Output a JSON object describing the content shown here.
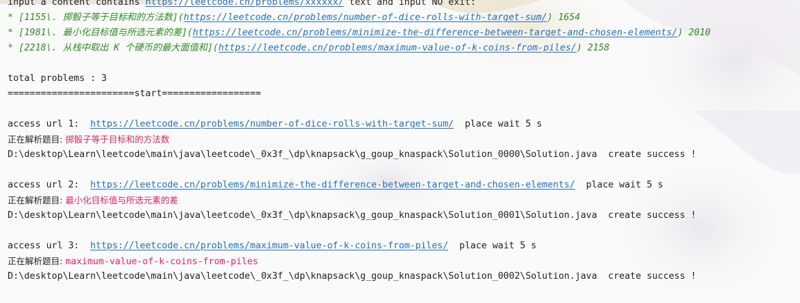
{
  "console": {
    "header": {
      "prefix": "input a content contains ",
      "link": "https://leetcode.cn/problems/xxxxxx/",
      "suffix": " text and input NO exit:"
    },
    "items": [
      {
        "prefix": "* [",
        "id": "1155\\.",
        "title_cn": " 掷骰子等于目标和的方法数",
        "mid": "](",
        "link": "https://leetcode.cn/problems/number-of-dice-rolls-with-target-sum/",
        "suffix": ") 1654"
      },
      {
        "prefix": "* [",
        "id": "1981\\.",
        "title_cn": " 最小化目标值与所选元素的差",
        "mid": "](",
        "link": "https://leetcode.cn/problems/minimize-the-difference-between-target-and-chosen-elements/",
        "suffix": ") 2010"
      },
      {
        "prefix": "* [",
        "id": "2218\\.",
        "title_cn": " 从栈中取出 K 个硬币的最大面值和",
        "mid": "](",
        "link": "https://leetcode.cn/problems/maximum-value-of-k-coins-from-piles/",
        "suffix": ") 2158"
      }
    ],
    "total": "total problems : 3",
    "start": "=======================start==================",
    "access": [
      {
        "prefix": "access url 1:  ",
        "link": "https://leetcode.cn/problems/number-of-dice-rolls-with-target-sum/",
        "wait": "  place wait 5 s",
        "parse_label": "正在解析题目: ",
        "parse_value": "掷骰子等于目标和的方法数",
        "path": "D:\\desktop\\Learn\\leetcode\\main\\java\\leetcode\\_0x3f_\\dp\\knapsack\\g_goup_knaspack\\Solution_0000\\Solution.java  create success !"
      },
      {
        "prefix": "access url 2:  ",
        "link": "https://leetcode.cn/problems/minimize-the-difference-between-target-and-chosen-elements/",
        "wait": "  place wait 5 s",
        "parse_label": "正在解析题目: ",
        "parse_value": "最小化目标值与所选元素的差",
        "path": "D:\\desktop\\Learn\\leetcode\\main\\java\\leetcode\\_0x3f_\\dp\\knapsack\\g_goup_knaspack\\Solution_0001\\Solution.java  create success !"
      },
      {
        "prefix": "access url 3:  ",
        "link": "https://leetcode.cn/problems/maximum-value-of-k-coins-from-piles/",
        "wait": "  place wait 5 s",
        "parse_label": "正在解析题目: ",
        "parse_value": "maximum-value-of-k-coins-from-piles",
        "path": "D:\\desktop\\Learn\\leetcode\\main\\java\\leetcode\\_0x3f_\\dp\\knapsack\\g_goup_knaspack\\Solution_0002\\Solution.java  create success !"
      }
    ]
  },
  "colors": {
    "background": "#fafafa",
    "text": "#1f1f1f",
    "link": "#2470b3",
    "markdown_green": "#2f8a23",
    "highlight_pink": "#d02a64"
  }
}
